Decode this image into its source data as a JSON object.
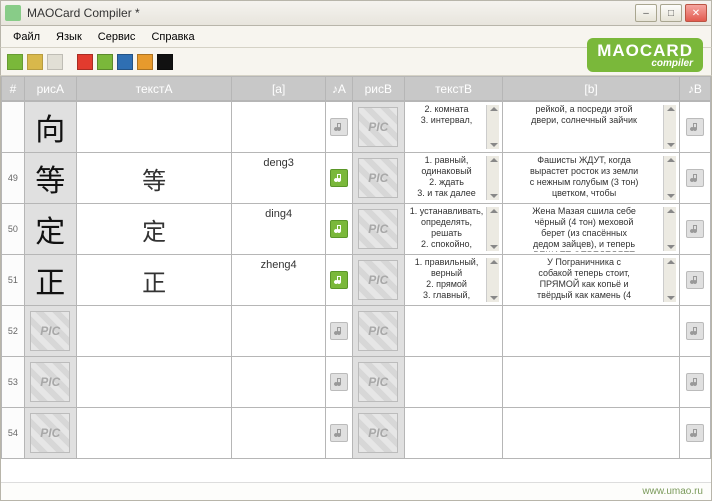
{
  "window": {
    "title": "MAOCard Compiler *"
  },
  "menu": {
    "file": "Файл",
    "lang": "Язык",
    "service": "Сервис",
    "help": "Справка"
  },
  "logo": {
    "line1": "MAOCARD",
    "line2": "compiler"
  },
  "swatches": [
    "#e23b2e",
    "#7ab83a",
    "#2f6fb3",
    "#e79a2d",
    "#111111"
  ],
  "headers": {
    "num": "#",
    "picA": "рисA",
    "textA": "текстA",
    "a": "[a]",
    "noteA": "♪A",
    "picB": "рисB",
    "textB": "текстB",
    "b": "[b]",
    "noteB": "♪B"
  },
  "picPlaceholder": "PIC",
  "rows": [
    {
      "num": "",
      "glyph": "向",
      "textA": "",
      "a": "",
      "textB": "2. комната\n3. интервал,",
      "b": "рейкой, а посреди этой\nдвери, солнечный зайчик",
      "playA": false,
      "playB": false
    },
    {
      "num": "49",
      "glyph": "等",
      "textA": "等",
      "a": "deng3",
      "textB": "1. равный,\nодинаковый\n2. ждать\n3. и так далее",
      "b": "Фашисты ЖДУТ, когда\nвырастет росток из земли\nс нежным голубым (3 тон)\nцветком, чтобы",
      "playA": true,
      "playB": false
    },
    {
      "num": "50",
      "glyph": "定",
      "textA": "定",
      "a": "ding4",
      "textB": "1. устанавливать,\nопределять,\nрешать\n2. спокойно,",
      "b": "Жена Мазая сшила себе\nчёрный (4 тон) меховой\nберет (из спасённых\nдедом зайцев), и теперь\nРЕШАЕТ ОПРЕДЕЛЯЕТ",
      "playA": true,
      "playB": false
    },
    {
      "num": "51",
      "glyph": "正",
      "textA": "正",
      "a": "zheng4",
      "textB": "1. правильный,\nверный\n2. прямой\n3. главный,",
      "b": "У Пограничника с\nсобакой теперь стоит,\nПРЯМОЙ как копьё и\nтвёрдый как камень (4",
      "playA": true,
      "playB": false
    },
    {
      "num": "52",
      "glyph": "",
      "textA": "",
      "a": "",
      "textB": "",
      "b": "",
      "playA": false,
      "playB": false
    },
    {
      "num": "53",
      "glyph": "",
      "textA": "",
      "a": "",
      "textB": "",
      "b": "",
      "playA": false,
      "playB": false
    },
    {
      "num": "54",
      "glyph": "",
      "textA": "",
      "a": "",
      "textB": "",
      "b": "",
      "playA": false,
      "playB": false
    }
  ],
  "footer": {
    "url": "www.umao.ru"
  }
}
